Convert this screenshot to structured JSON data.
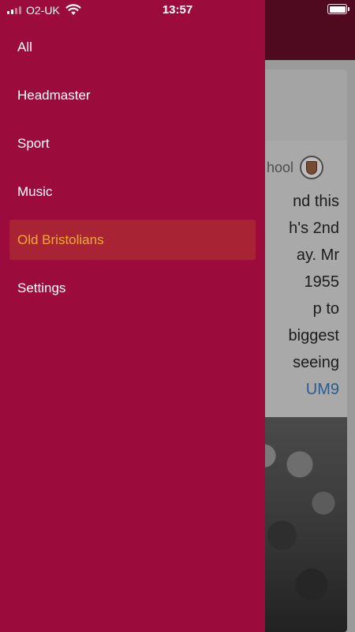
{
  "status_bar": {
    "carrier": "O2-UK",
    "time": "13:57",
    "signal_bars": 2,
    "battery_level": 1.0
  },
  "drawer": {
    "background_color": "#9b0c3d",
    "active_background_color": "#a82434",
    "active_text_color": "#f2a93b",
    "items": [
      {
        "label": "All",
        "active": false
      },
      {
        "label": "Headmaster",
        "active": false
      },
      {
        "label": "Sport",
        "active": false
      },
      {
        "label": "Music",
        "active": false
      },
      {
        "label": "Old Bristolians",
        "active": true
      },
      {
        "label": "Settings",
        "active": false
      }
    ]
  },
  "background_feed": {
    "author_fragment": "hool",
    "text_lines": [
      "nd this",
      "h's 2nd",
      "ay. Mr",
      "1955",
      "p to",
      "biggest",
      "seeing"
    ],
    "link_fragment": "UM9",
    "icons": {
      "crest": "school-crest-icon"
    }
  }
}
